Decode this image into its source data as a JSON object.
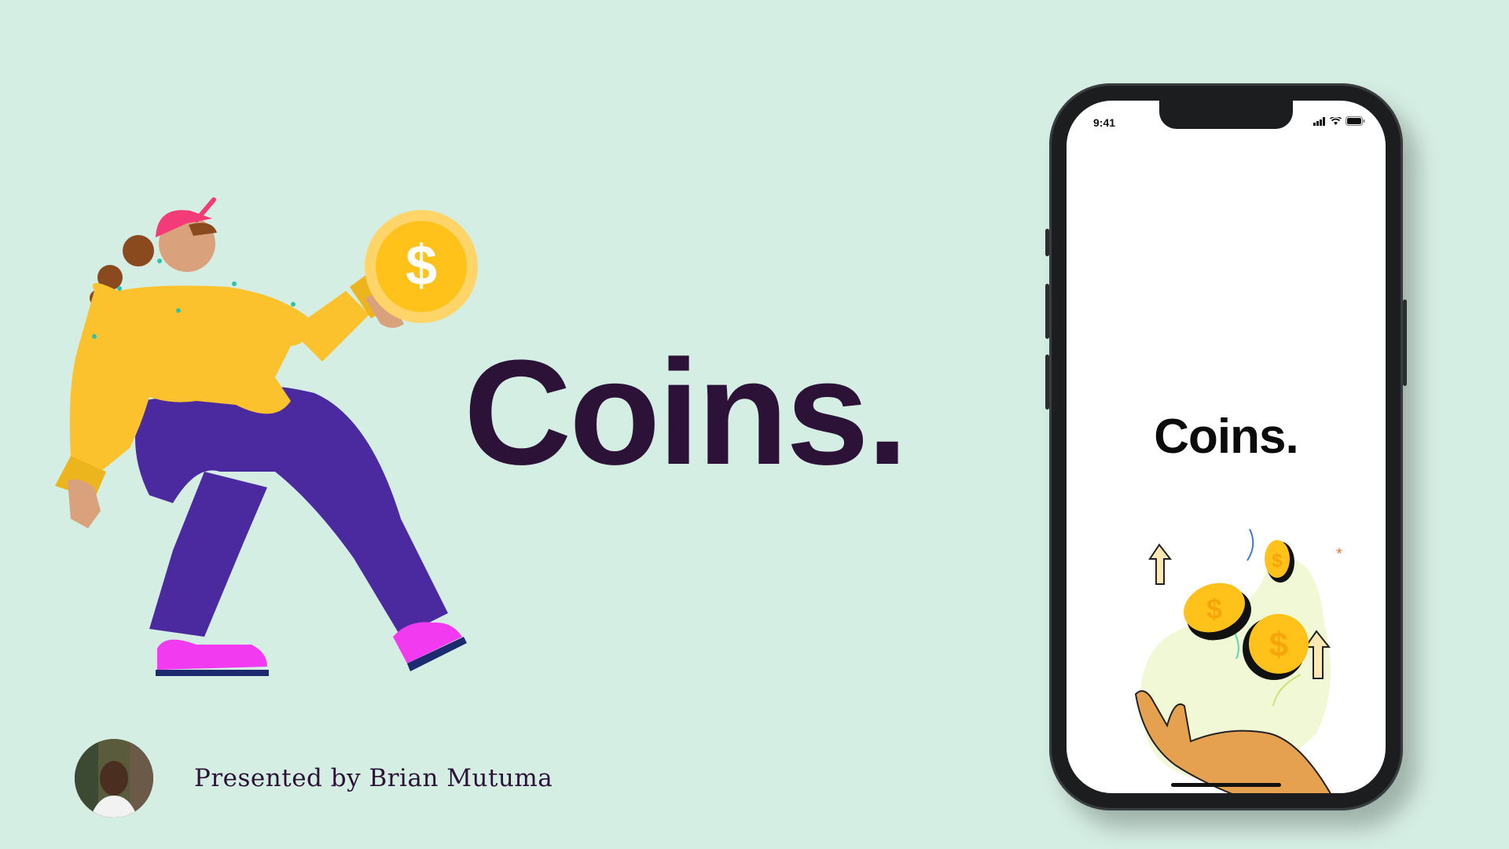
{
  "hero": {
    "title": "Coins."
  },
  "presenter": {
    "text": "Presented by Brian Mutuma"
  },
  "phone": {
    "status_time": "9:41",
    "screen_title": "Coins."
  },
  "colors": {
    "background": "#d5eee3",
    "title": "#2d1238",
    "coin": "#ffc21a",
    "sweater": "#fcc22d",
    "pants": "#4b2aa0",
    "shoes": "#f23bf0",
    "cap": "#f23b78"
  },
  "icons": [
    "dollar-coin-icon",
    "signal-icon",
    "wifi-icon",
    "battery-icon",
    "arrow-up-icon"
  ]
}
